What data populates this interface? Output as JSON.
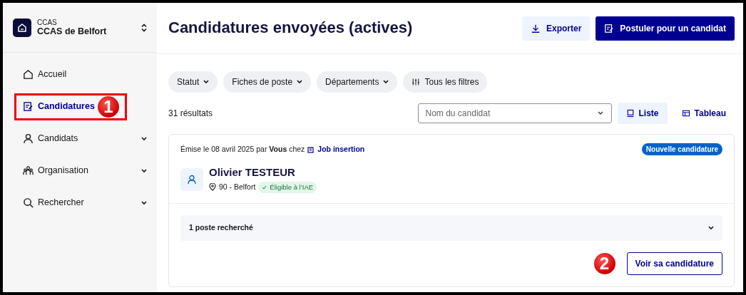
{
  "org": {
    "type": "CCAS",
    "name": "CCAS de Belfort"
  },
  "nav": [
    {
      "label": "Accueil",
      "selected": false,
      "expandable": false
    },
    {
      "label": "Candidatures",
      "selected": true,
      "expandable": false,
      "annotation": "1"
    },
    {
      "label": "Candidats",
      "selected": false,
      "expandable": true
    },
    {
      "label": "Organisation",
      "selected": false,
      "expandable": true
    },
    {
      "label": "Rechercher",
      "selected": false,
      "expandable": true
    }
  ],
  "header": {
    "title": "Candidatures envoyées (actives)",
    "buttons": [
      {
        "label": "Exporter",
        "kind": "secondary"
      },
      {
        "label": "Postuler pour un candidat",
        "kind": "primary"
      }
    ]
  },
  "filters": [
    {
      "label": "Statut",
      "kind": "dropdown"
    },
    {
      "label": "Fiches de poste",
      "kind": "dropdown"
    },
    {
      "label": "Départements",
      "kind": "dropdown"
    },
    {
      "label": "Tous les filtres",
      "kind": "all"
    }
  ],
  "results": "31 résultats",
  "search": {
    "placeholder": "Nom du candidat"
  },
  "views": [
    {
      "label": "Liste",
      "selected": true
    },
    {
      "label": "Tableau",
      "selected": false
    }
  ],
  "card": {
    "emitted": "Émise le 08 avril 2025 par **Vous** chez",
    "company": "Job insertion",
    "badge": "Nouvelle candidature",
    "name": "Olivier TESTEUR",
    "location": "90 - Belfort",
    "eligibility": "Éligible à l’IAE",
    "jobs": "1 poste recherché",
    "action": "Voir sa candidature",
    "annotation": "2"
  }
}
